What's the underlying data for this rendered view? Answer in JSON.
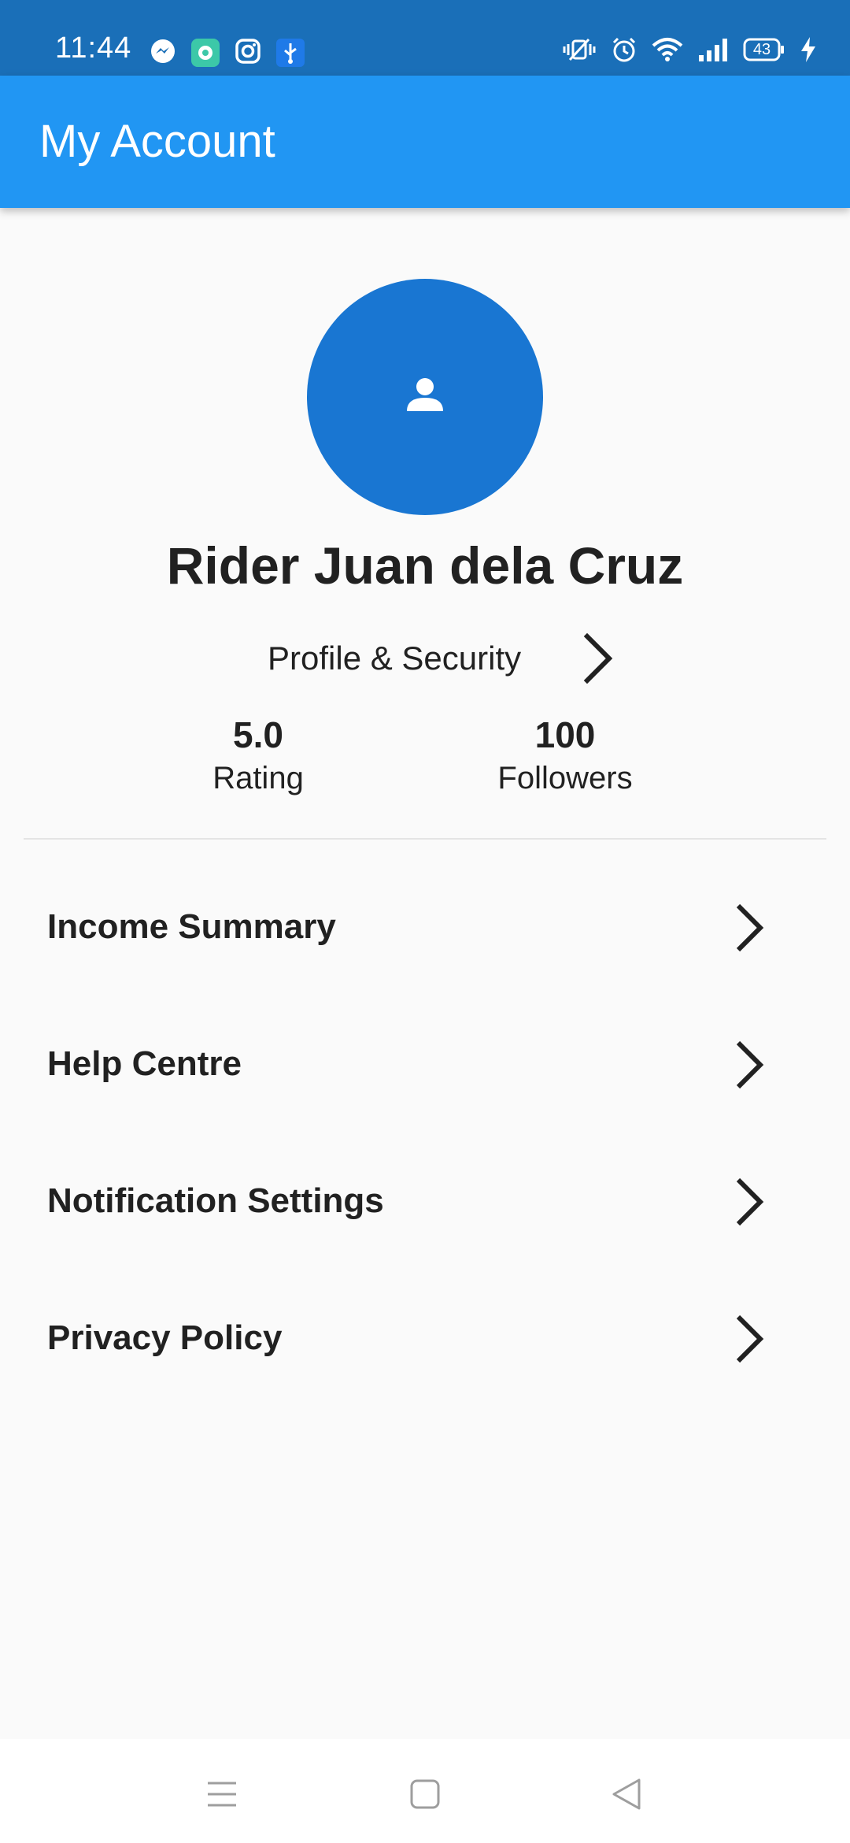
{
  "status_bar": {
    "time": "11:44",
    "battery": "43",
    "left_icons": [
      "messenger-icon",
      "chat-app-icon",
      "instagram-icon",
      "usb-icon"
    ],
    "right_icons": [
      "vibrate-icon",
      "alarm-icon",
      "wifi-icon",
      "signal-icon",
      "battery-icon",
      "charging-icon"
    ]
  },
  "app_bar": {
    "title": "My Account"
  },
  "profile": {
    "avatar_icon": "person-icon",
    "name": "Rider Juan dela Cruz",
    "link_label": "Profile & Security"
  },
  "stats": {
    "rating": {
      "value": "5.0",
      "label": "Rating"
    },
    "followers": {
      "value": "100",
      "label": "Followers"
    }
  },
  "menu": [
    {
      "label": "Income Summary"
    },
    {
      "label": "Help Centre"
    },
    {
      "label": "Notification Settings"
    },
    {
      "label": "Privacy Policy"
    }
  ],
  "nav": [
    "recents-icon",
    "home-icon",
    "back-icon"
  ],
  "colors": {
    "status_bar": "#1a6fb8",
    "app_bar": "#2196f3",
    "avatar": "#1976d2",
    "background": "#fafafa"
  }
}
